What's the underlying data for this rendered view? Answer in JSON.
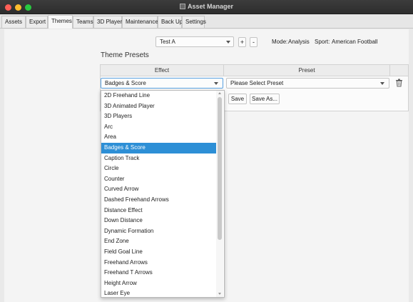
{
  "window": {
    "title": "Asset Manager",
    "icon": "asset-manager-app-icon"
  },
  "tabs": [
    {
      "label": "Assets",
      "active": false
    },
    {
      "label": "Export",
      "active": false
    },
    {
      "label": "Themes",
      "active": true
    },
    {
      "label": "Teams",
      "active": false
    },
    {
      "label": "3D Players",
      "active": false
    },
    {
      "label": "Maintenance",
      "active": false
    },
    {
      "label": "Back Up",
      "active": false
    },
    {
      "label": "Settings",
      "active": false
    }
  ],
  "theme_selector": {
    "selected": "Test A",
    "add_label": "+",
    "remove_label": "-"
  },
  "mode": {
    "label": "Mode:",
    "value": "Analysis"
  },
  "sport": {
    "label": "Sport:",
    "value": "American Football"
  },
  "section_title": "Theme Presets",
  "table": {
    "columns": [
      "Effect",
      "Preset"
    ]
  },
  "effect_combo": {
    "selected": "Badges & Score"
  },
  "preset_combo": {
    "selected": "Please Select Preset"
  },
  "buttons": {
    "save": "Save",
    "save_as": "Save As..."
  },
  "delete_icon": "trash-icon",
  "effect_options": [
    "2D Freehand Line",
    "3D Animated Player",
    "3D Players",
    "Arc",
    "Area",
    "Badges & Score",
    "Caption Track",
    "Circle",
    "Counter",
    "Curved Arrow",
    "Dashed Freehand Arrows",
    "Distance Effect",
    "Down Distance",
    "Dynamic Formation",
    "End Zone",
    "Field Goal Line",
    "Freehand Arrows",
    "Freehand T Arrows",
    "Height Arrow",
    "Laser Eye"
  ],
  "colors": {
    "selection": "#2d8fd6",
    "close": "#ff5f57",
    "minimize": "#febc2e",
    "maximize": "#28c840"
  }
}
